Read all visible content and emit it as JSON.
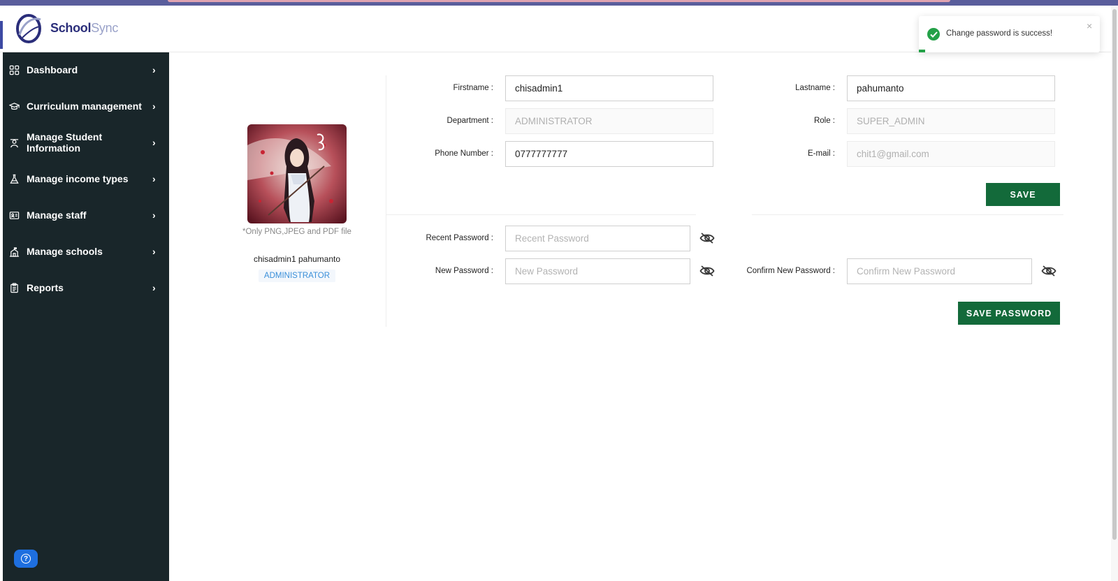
{
  "app": {
    "brand_part1": "School",
    "brand_part2": "Sync"
  },
  "sidebar": {
    "items": [
      {
        "label": "Dashboard",
        "icon": "grid-icon"
      },
      {
        "label": "Curriculum management",
        "icon": "graduation-cap-icon"
      },
      {
        "label": "Manage Student Information",
        "icon": "student-icon"
      },
      {
        "label": "Manage income types",
        "icon": "flask-icon"
      },
      {
        "label": "Manage staff",
        "icon": "id-card-icon"
      },
      {
        "label": "Manage schools",
        "icon": "building-icon"
      },
      {
        "label": "Reports",
        "icon": "clipboard-icon"
      }
    ],
    "help_icon": "question-circle-icon"
  },
  "profile": {
    "file_note": "*Only PNG,JPEG and PDF file",
    "full_name": "chisadmin1 pahumanto",
    "role_badge": "ADMINISTRATOR"
  },
  "form": {
    "firstname_label": "Firstname :",
    "firstname_value": "chisadmin1",
    "lastname_label": "Lastname :",
    "lastname_value": "pahumanto",
    "department_label": "Department :",
    "department_value": "ADMINISTRATOR",
    "role_label": "Role :",
    "role_value": "SUPER_ADMIN",
    "phone_label": "Phone Number :",
    "phone_value": "0777777777",
    "email_label": "E-mail :",
    "email_value": "chit1@gmail.com",
    "save_label": "SAVE"
  },
  "password": {
    "recent_label": "Recent Password :",
    "recent_placeholder": "Recent Password",
    "new_label": "New Password :",
    "new_placeholder": "New Password",
    "confirm_label": "Confirm New Password :",
    "confirm_placeholder": "Confirm New Password",
    "save_label": "SAVE PASSWORD"
  },
  "toast": {
    "message": "Change password is success!",
    "close": "×"
  },
  "colors": {
    "sidebar_bg": "#19262a",
    "button_green": "#136a3a",
    "link_blue": "#3a8fd9",
    "success_green": "#24a148"
  }
}
